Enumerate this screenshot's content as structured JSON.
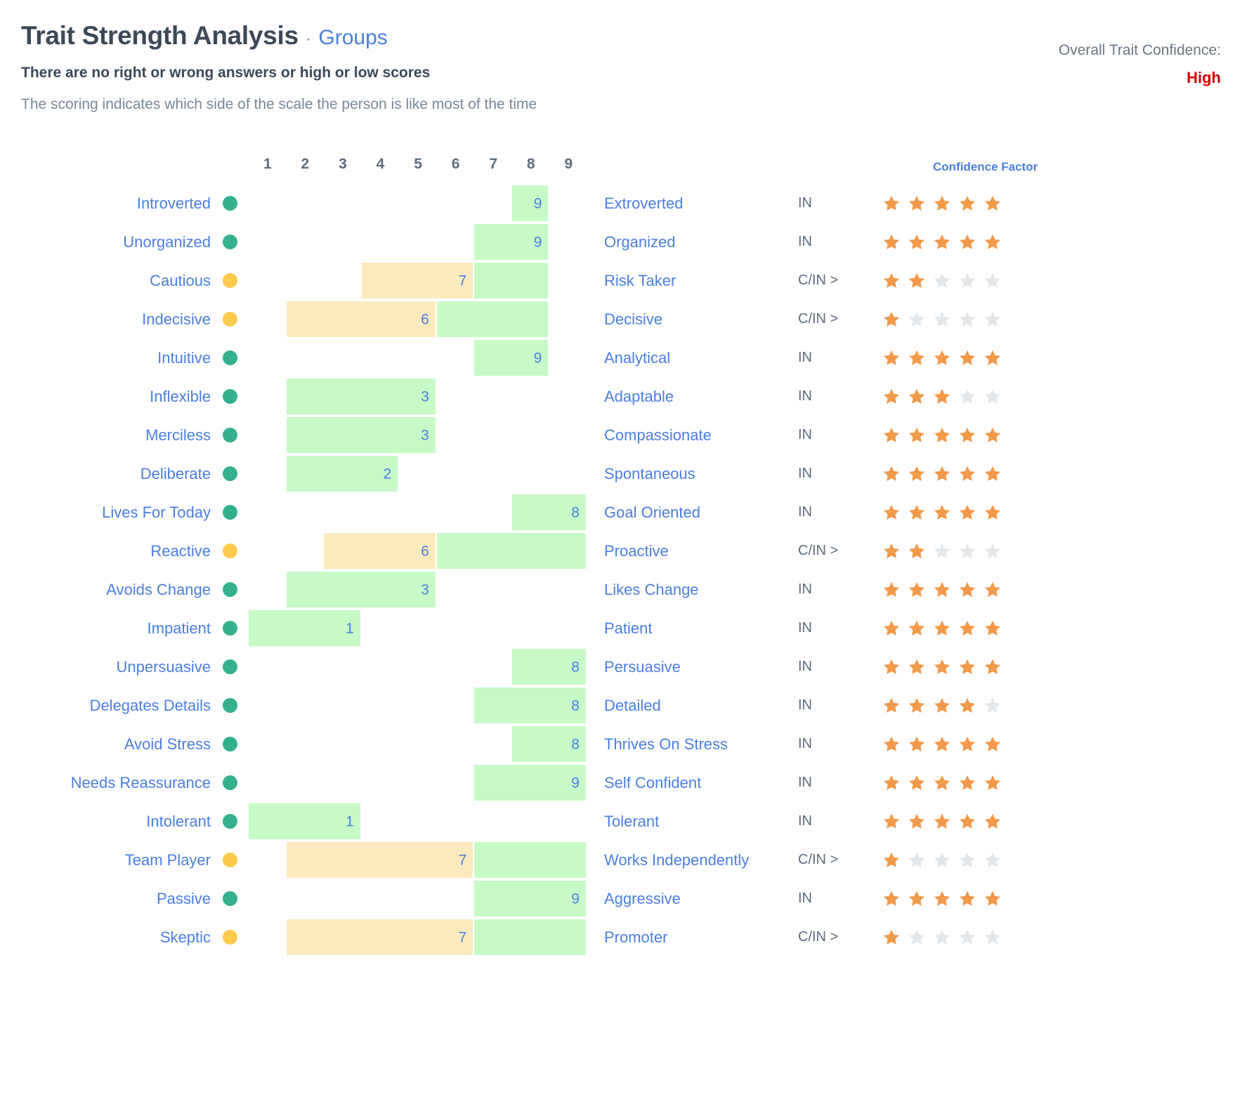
{
  "header": {
    "title": "Trait Strength Analysis",
    "separator": "·",
    "subtitle_link": "Groups",
    "subtitle": "There are no right or wrong answers or high or low scores",
    "description": "The scoring indicates which side of the scale the person is like most of the time",
    "overall_confidence_label": "Overall Trait Confidence:",
    "overall_confidence_value": "High",
    "overall_confidence_color": "#d40000",
    "confidence_factor_header": "Confidence Factor"
  },
  "colors": {
    "link_blue": "#4a7fe0",
    "dot_green": "#34b08c",
    "dot_yellow": "#fccb4e",
    "bar_green": "#c8fac8",
    "bar_yellow": "#faeabe",
    "star_on": "#f2994a",
    "star_off": "#e4e7ea",
    "axis_text": "#5f6b7a"
  },
  "scale": {
    "ticks": [
      "1",
      "2",
      "3",
      "4",
      "5",
      "6",
      "7",
      "8",
      "9"
    ],
    "min": 1,
    "max": 9
  },
  "chart_data": {
    "type": "bar",
    "title": "Trait Strength Analysis",
    "subtitle": "There are no right or wrong answers or high or low scores",
    "xlabel": "",
    "ylabel": "",
    "xlim": [
      1,
      9
    ],
    "grid": false,
    "legend": "none",
    "categories": [
      "Introverted / Extroverted",
      "Unorganized / Organized",
      "Cautious / Risk Taker",
      "Indecisive / Decisive",
      "Intuitive / Analytical",
      "Inflexible / Adaptable",
      "Merciless / Compassionate",
      "Deliberate / Spontaneous",
      "Lives For Today / Goal Oriented",
      "Reactive / Proactive",
      "Avoids Change / Likes Change",
      "Impatient / Patient",
      "Unpersuasive / Persuasive",
      "Delegates Details / Detailed",
      "Avoid Stress / Thrives On Stress",
      "Needs Reassurance / Self Confident",
      "Intolerant / Tolerant",
      "Team Player / Works Independently",
      "Passive / Aggressive",
      "Skeptic / Promoter"
    ],
    "values": [
      9,
      9,
      7,
      6,
      9,
      3,
      3,
      2,
      8,
      6,
      3,
      1,
      8,
      8,
      8,
      9,
      1,
      7,
      9,
      7
    ],
    "stars": [
      5,
      5,
      2,
      1,
      5,
      3,
      5,
      5,
      5,
      2,
      5,
      5,
      5,
      4,
      5,
      5,
      5,
      1,
      5,
      1
    ]
  },
  "rows": [
    {
      "left": "Introverted",
      "dot": "green",
      "score": "9",
      "bar_start": 8,
      "bar_end": 9,
      "bar_color": "green",
      "second_bar": null,
      "right": "Extroverted",
      "code": "IN",
      "stars": 5
    },
    {
      "left": "Unorganized",
      "dot": "green",
      "score": "9",
      "bar_start": 7,
      "bar_end": 9,
      "bar_color": "green",
      "second_bar": null,
      "right": "Organized",
      "code": "IN",
      "stars": 5
    },
    {
      "left": "Cautious",
      "dot": "yellow",
      "score": "7",
      "bar_start": 4,
      "bar_end": 7,
      "bar_color": "yellow",
      "second_bar": {
        "start": 7,
        "end": 9,
        "color": "green"
      },
      "right": "Risk Taker",
      "code": "C/IN >",
      "stars": 2
    },
    {
      "left": "Indecisive",
      "dot": "yellow",
      "score": "6",
      "bar_start": 2,
      "bar_end": 6,
      "bar_color": "yellow",
      "second_bar": {
        "start": 6,
        "end": 9,
        "color": "green"
      },
      "right": "Decisive",
      "code": "C/IN >",
      "stars": 1
    },
    {
      "left": "Intuitive",
      "dot": "green",
      "score": "9",
      "bar_start": 7,
      "bar_end": 9,
      "bar_color": "green",
      "second_bar": null,
      "right": "Analytical",
      "code": "IN",
      "stars": 5
    },
    {
      "left": "Inflexible",
      "dot": "green",
      "score": "3",
      "bar_start": 2,
      "bar_end": 6,
      "bar_color": "green",
      "second_bar": null,
      "right": "Adaptable",
      "code": "IN",
      "stars": 3
    },
    {
      "left": "Merciless",
      "dot": "green",
      "score": "3",
      "bar_start": 2,
      "bar_end": 6,
      "bar_color": "green",
      "second_bar": null,
      "right": "Compassionate",
      "code": "IN",
      "stars": 5
    },
    {
      "left": "Deliberate",
      "dot": "green",
      "score": "2",
      "bar_start": 2,
      "bar_end": 5,
      "bar_color": "green",
      "second_bar": null,
      "right": "Spontaneous",
      "code": "IN",
      "stars": 5
    },
    {
      "left": "Lives For Today",
      "dot": "green",
      "score": "8",
      "bar_start": 8,
      "bar_end": 10,
      "bar_color": "green",
      "second_bar": null,
      "right": "Goal Oriented",
      "code": "IN",
      "stars": 5
    },
    {
      "left": "Reactive",
      "dot": "yellow",
      "score": "6",
      "bar_start": 3,
      "bar_end": 6,
      "bar_color": "yellow",
      "second_bar": {
        "start": 6,
        "end": 10,
        "color": "green"
      },
      "right": "Proactive",
      "code": "C/IN >",
      "stars": 2
    },
    {
      "left": "Avoids Change",
      "dot": "green",
      "score": "3",
      "bar_start": 2,
      "bar_end": 6,
      "bar_color": "green",
      "second_bar": null,
      "right": "Likes Change",
      "code": "IN",
      "stars": 5
    },
    {
      "left": "Impatient",
      "dot": "green",
      "score": "1",
      "bar_start": 1,
      "bar_end": 4,
      "bar_color": "green",
      "second_bar": null,
      "right": "Patient",
      "code": "IN",
      "stars": 5
    },
    {
      "left": "Unpersuasive",
      "dot": "green",
      "score": "8",
      "bar_start": 8,
      "bar_end": 10,
      "bar_color": "green",
      "second_bar": null,
      "right": "Persuasive",
      "code": "IN",
      "stars": 5
    },
    {
      "left": "Delegates Details",
      "dot": "green",
      "score": "8",
      "bar_start": 7,
      "bar_end": 10,
      "bar_color": "green",
      "second_bar": null,
      "right": "Detailed",
      "code": "IN",
      "stars": 4
    },
    {
      "left": "Avoid Stress",
      "dot": "green",
      "score": "8",
      "bar_start": 8,
      "bar_end": 10,
      "bar_color": "green",
      "second_bar": null,
      "right": "Thrives On Stress",
      "code": "IN",
      "stars": 5
    },
    {
      "left": "Needs Reassurance",
      "dot": "green",
      "score": "9",
      "bar_start": 7,
      "bar_end": 10,
      "bar_color": "green",
      "second_bar": null,
      "right": "Self Confident",
      "code": "IN",
      "stars": 5
    },
    {
      "left": "Intolerant",
      "dot": "green",
      "score": "1",
      "bar_start": 1,
      "bar_end": 4,
      "bar_color": "green",
      "second_bar": null,
      "right": "Tolerant",
      "code": "IN",
      "stars": 5
    },
    {
      "left": "Team Player",
      "dot": "yellow",
      "score": "7",
      "bar_start": 2,
      "bar_end": 7,
      "bar_color": "yellow",
      "second_bar": {
        "start": 7,
        "end": 10,
        "color": "green"
      },
      "right": "Works Independently",
      "code": "C/IN >",
      "stars": 1
    },
    {
      "left": "Passive",
      "dot": "green",
      "score": "9",
      "bar_start": 7,
      "bar_end": 10,
      "bar_color": "green",
      "second_bar": null,
      "right": "Aggressive",
      "code": "IN",
      "stars": 5
    },
    {
      "left": "Skeptic",
      "dot": "yellow",
      "score": "7",
      "bar_start": 2,
      "bar_end": 7,
      "bar_color": "yellow",
      "second_bar": {
        "start": 7,
        "end": 10,
        "color": "green"
      },
      "right": "Promoter",
      "code": "C/IN >",
      "stars": 1
    }
  ]
}
